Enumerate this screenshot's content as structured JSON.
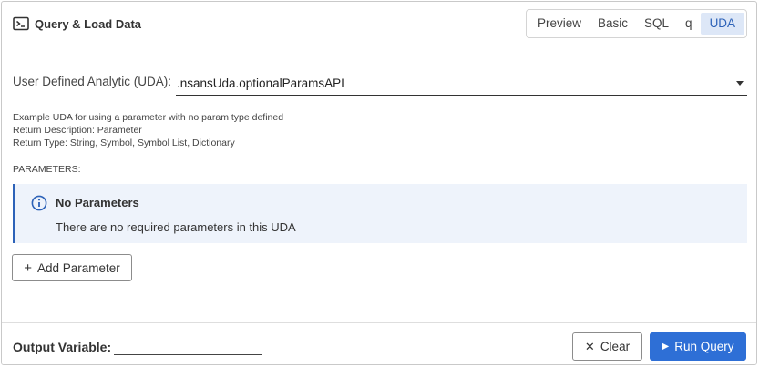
{
  "header": {
    "title": "Query & Load Data",
    "icon": "terminal-icon"
  },
  "tabs": [
    {
      "label": "Preview",
      "active": false
    },
    {
      "label": "Basic",
      "active": false
    },
    {
      "label": "SQL",
      "active": false
    },
    {
      "label": "q",
      "active": false
    },
    {
      "label": "UDA",
      "active": true
    }
  ],
  "uda": {
    "label": "User Defined Analytic (UDA):",
    "selected": ".nsansUda.optionalParamsAPI",
    "description_lines": [
      "Example UDA for using a parameter with no param type defined",
      "Return Description: Parameter",
      "Return Type: String, Symbol, Symbol List, Dictionary"
    ],
    "parameters_heading": "PARAMETERS:"
  },
  "info": {
    "icon": "info-icon",
    "title": "No Parameters",
    "text": "There are no required parameters in this UDA",
    "accent": "#2d62b8",
    "background": "#eef3fb"
  },
  "actions": {
    "add_parameter": "Add Parameter"
  },
  "footer": {
    "output_label": "Output Variable:",
    "output_value": "",
    "clear_label": "Clear",
    "run_label": "Run Query",
    "run_color": "#2e6fd6"
  }
}
